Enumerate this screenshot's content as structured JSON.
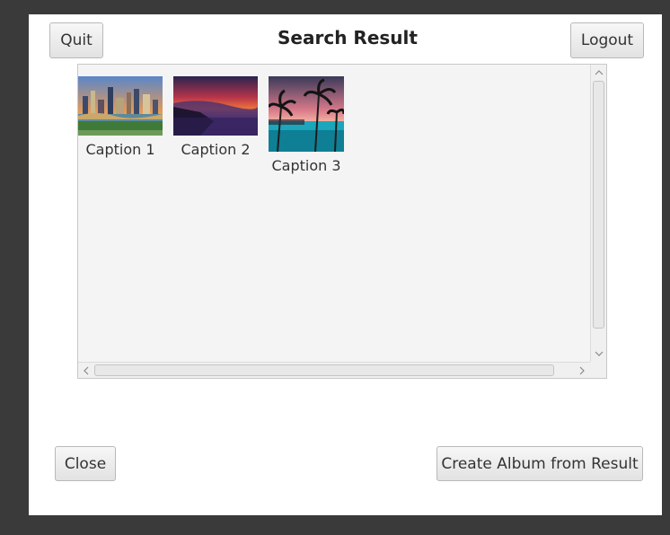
{
  "header": {
    "quit_label": "Quit",
    "title": "Search Result",
    "logout_label": "Logout"
  },
  "results": {
    "items": [
      {
        "caption": "Caption 1",
        "thumbnail": "city-skyline-photo"
      },
      {
        "caption": "Caption 2",
        "thumbnail": "sunset-coast-photo"
      },
      {
        "caption": "Caption 3",
        "thumbnail": "palm-pool-photo"
      }
    ]
  },
  "footer": {
    "close_label": "Close",
    "create_album_label": "Create Album from Result"
  },
  "scrollbars": {
    "up_icon": "chevron-up-icon",
    "down_icon": "chevron-down-icon",
    "left_icon": "chevron-left-icon",
    "right_icon": "chevron-right-icon"
  }
}
